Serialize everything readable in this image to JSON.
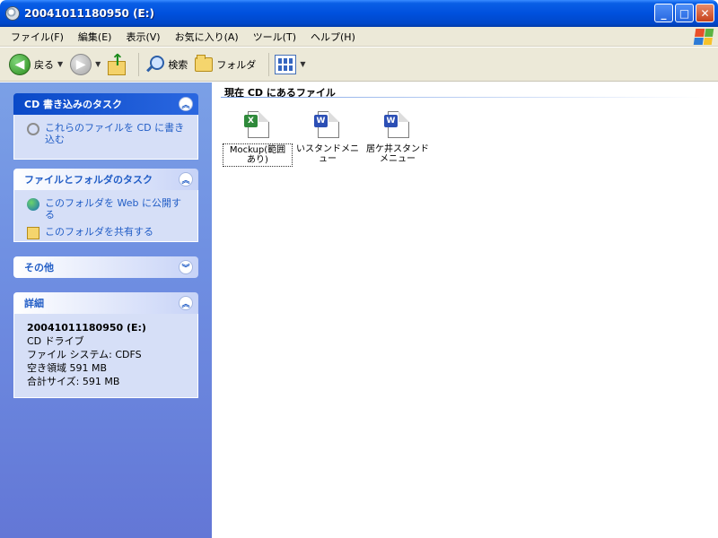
{
  "window": {
    "title": "20041011180950 (E:)"
  },
  "menu": [
    "ファイル(F)",
    "編集(E)",
    "表示(V)",
    "お気に入り(A)",
    "ツール(T)",
    "ヘルプ(H)"
  ],
  "toolbar": {
    "back_label": "戻る",
    "search_label": "検索",
    "folders_label": "フォルダ"
  },
  "tasks": {
    "cd": {
      "title": "CD 書き込みのタスク",
      "items": [
        "これらのファイルを CD に書き込む"
      ]
    },
    "file_folder": {
      "title": "ファイルとフォルダのタスク",
      "items": [
        "このフォルダを Web に公開する",
        "このフォルダを共有する"
      ]
    },
    "other": {
      "title": "その他"
    },
    "details": {
      "title": "詳細",
      "name": "20041011180950 (E:)",
      "type": "CD ドライブ",
      "filesystem": "ファイル システム: CDFS",
      "free": "空き領域 591 MB",
      "total": "合計サイズ: 591 MB"
    }
  },
  "content": {
    "group_title": "現在 CD にあるファイル",
    "files": [
      {
        "label": "Mockup(範囲あり)",
        "type": "xls",
        "badge": "X"
      },
      {
        "label": "いスタンドメニュー",
        "type": "doc",
        "badge": "W"
      },
      {
        "label": "居ケ井スタンドメニュー",
        "type": "doc",
        "badge": "W"
      }
    ]
  }
}
